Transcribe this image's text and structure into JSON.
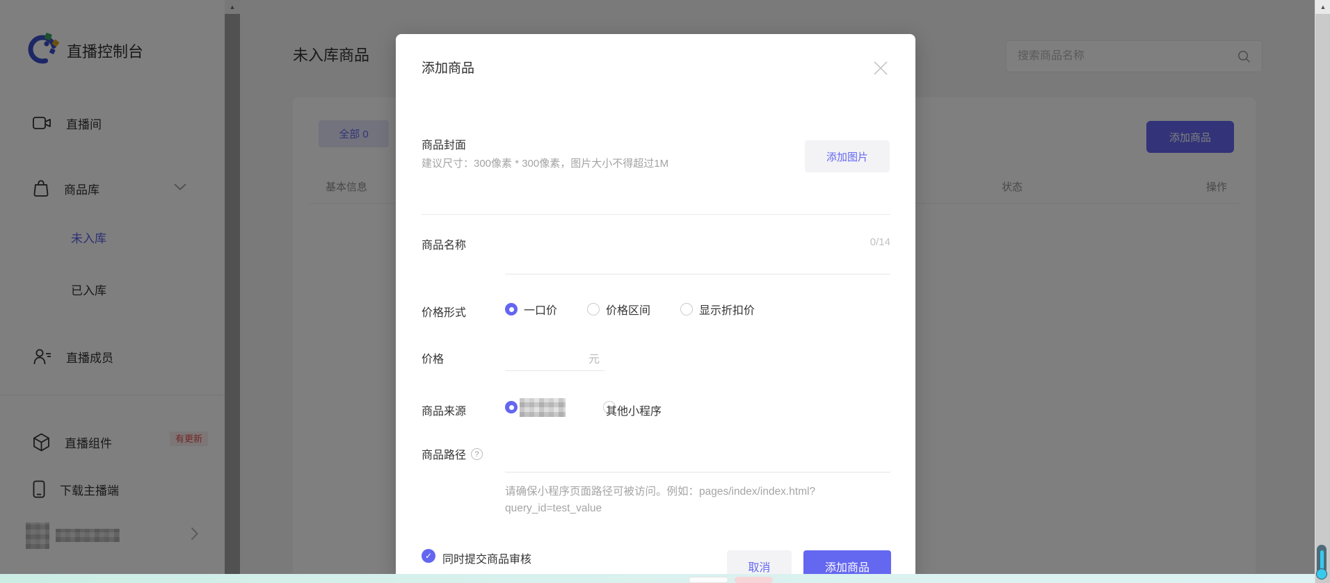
{
  "colors": {
    "brand": "#6467f0",
    "badge_red": "#e34d4d",
    "active_nav": "#5b5ee8",
    "strip_teal": "#d3efe9"
  },
  "sidebar": {
    "title": "直播控制台",
    "items": [
      {
        "label": "直播间",
        "icon": "video-icon"
      },
      {
        "label": "商品库",
        "icon": "bag-icon",
        "state": "expanded"
      },
      {
        "label": "未入库",
        "active": true
      },
      {
        "label": "已入库",
        "active": false
      },
      {
        "label": "直播成员",
        "icon": "members-icon"
      },
      {
        "label": "直播组件",
        "icon": "cube-icon",
        "badge": "有更新"
      },
      {
        "label": "下载主播端",
        "icon": "phone-icon"
      }
    ],
    "user_row": {
      "blurred": true,
      "chevron": "›"
    }
  },
  "main": {
    "page_title": "未入库商品",
    "search": {
      "placeholder": "搜索商品名称"
    },
    "tabs": [
      {
        "label": "全部 0",
        "active": true
      }
    ],
    "add_button": "添加商品",
    "table": {
      "headers": [
        "基本信息",
        "状态",
        "操作"
      ]
    }
  },
  "modal": {
    "title": "添加商品",
    "cover": {
      "label": "商品封面",
      "hint": "建议尺寸：300像素 * 300像素，图片大小不得超过1M",
      "button": "添加图片"
    },
    "name": {
      "label": "商品名称",
      "counter": "0/14",
      "value": ""
    },
    "price_type": {
      "label": "价格形式",
      "options": [
        {
          "label": "一口价",
          "selected": true
        },
        {
          "label": "价格区间",
          "selected": false
        },
        {
          "label": "显示折扣价",
          "selected": false
        }
      ]
    },
    "price": {
      "label": "价格",
      "unit": "元",
      "value": ""
    },
    "source": {
      "label": "商品来源",
      "options": [
        {
          "label": "",
          "selected": true,
          "blurred": true
        },
        {
          "label": "其他小程序",
          "selected": false
        }
      ]
    },
    "path": {
      "label": "商品路径",
      "help": "?",
      "value": "",
      "helper": "请确保小程序页面路径可被访问。例如：pages/index/index.html?query_id=test_value"
    },
    "audit": {
      "label": "同时提交商品审核",
      "checked": true,
      "check_glyph": "✓"
    },
    "cancel_button": "取消",
    "submit_button": "添加商品"
  },
  "chrome": {
    "scroll_up_glyph": "▲"
  }
}
